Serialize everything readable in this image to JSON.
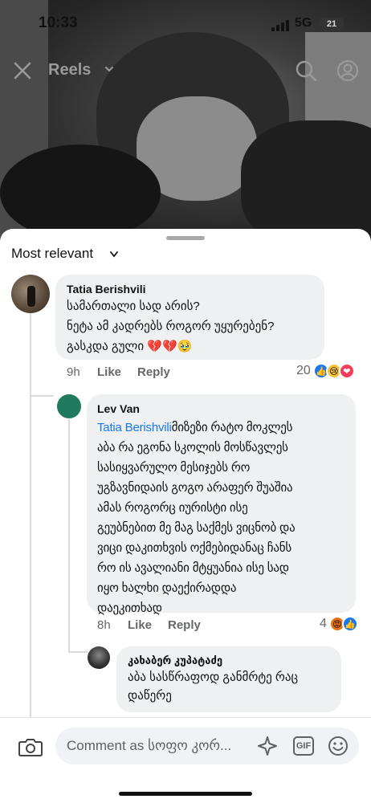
{
  "status_bar": {
    "time": "10:33",
    "network": "5G",
    "battery": "21"
  },
  "reels_header": {
    "title": "Reels"
  },
  "sort": {
    "label": "Most relevant"
  },
  "comments": [
    {
      "author": "Tatia Berishvili",
      "lines": [
        "სამართალი სად არის?",
        "ნეტა ამ კადრებს როგორ უყურებენ?",
        "გასკდა გული 💔💔🥹"
      ],
      "time": "9h",
      "like": "Like",
      "reply": "Reply",
      "reaction_count": "20"
    },
    {
      "author": "Lev Van",
      "mention": "Tatia Berishvili",
      "lines": [
        "მიზეზი რატო მოკლეს",
        "აბა რა ეგონა სკოლის მოსწავლეს",
        "სასიყვარულო მესიჯებს რო",
        "უგზავნიდაის გოგო არაფერ შუაშია",
        "ამას როგორც იურისტი ისე",
        "გეუბნებით მე მაგ საქმეს ვიცნობ და",
        "ვიცი დაკითხვის ოქმებიდანაც ჩანს",
        "რო ის ავალიანი მტყუანია ისე სად",
        "იყო ხალხი დაექირადდა",
        "დაეკითხად"
      ],
      "time": "8h",
      "like": "Like",
      "reply": "Reply",
      "reaction_count": "4"
    },
    {
      "author": "კახაბერ კუპატაძე",
      "lines": [
        "აბა სასწრაფოდ განმრტე რაც",
        "დაწერე"
      ]
    }
  ],
  "composer": {
    "placeholder": "Comment as სოფო კორ..."
  },
  "colors": {
    "link": "#1877f2",
    "bubble": "#eef0f2",
    "meta": "#65676b",
    "avatar_green": "#1f7a5e"
  },
  "icons": [
    "close-icon",
    "search-icon",
    "profile-icon",
    "camera-icon",
    "sparkle-sticker-icon",
    "gif-icon",
    "smile-icon"
  ]
}
